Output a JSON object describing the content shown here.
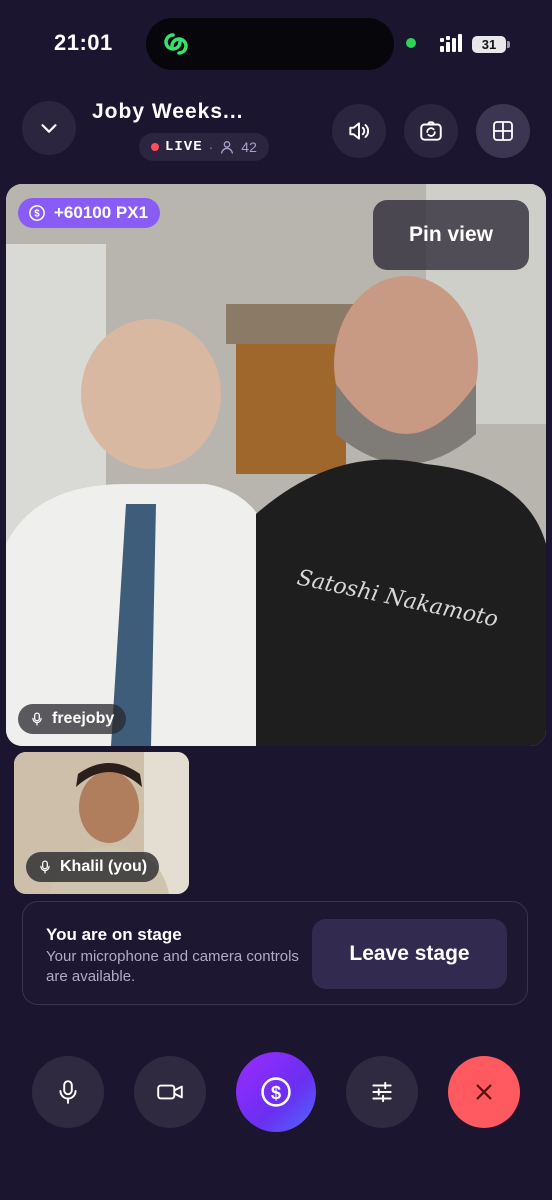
{
  "status_bar": {
    "time": "21:01",
    "battery": "31",
    "icons": [
      "app-logo-icon",
      "signal-icon",
      "battery-icon"
    ]
  },
  "header": {
    "title": "Joby Weeks...",
    "live_label": "LIVE",
    "separator": "·",
    "viewer_count": "42",
    "buttons": [
      "chevron-down-icon",
      "speaker-icon",
      "camera-switch-icon",
      "grid-layout-icon"
    ]
  },
  "main_video": {
    "badge": "+60100 PX1",
    "pin_label": "Pin view",
    "participant_name": "freejoby"
  },
  "self_video": {
    "participant_name": "Khalil (you)"
  },
  "stage_card": {
    "title": "You are on stage",
    "description": "Your microphone and camera controls are available.",
    "leave_label": "Leave stage"
  },
  "controls": [
    "microphone-icon",
    "video-camera-icon",
    "dollar-coin-icon",
    "sliders-icon",
    "close-icon"
  ],
  "colors": {
    "background": "#1c1530",
    "accent": "#8a5cf6",
    "live": "#ff4d5d",
    "end_call": "#ff5a5f",
    "online": "#2fd35a"
  }
}
